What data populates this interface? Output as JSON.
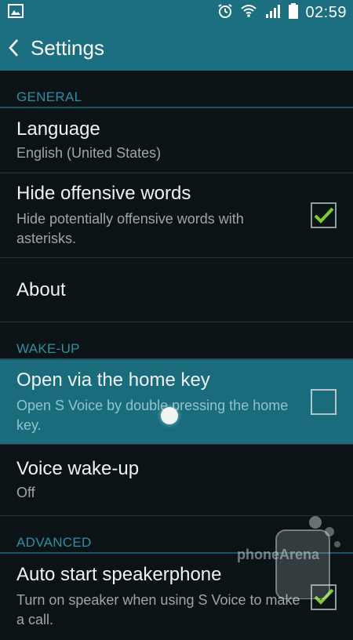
{
  "status_bar": {
    "time": "02:59",
    "icons": [
      "image-icon",
      "alarm-icon",
      "wifi-icon",
      "signal-icon",
      "battery-icon"
    ]
  },
  "action_bar": {
    "title": "Settings",
    "back_icon": "chevron-left-icon"
  },
  "sections": {
    "general": {
      "header": "GENERAL"
    },
    "wakeup": {
      "header": "WAKE-UP"
    },
    "advanced": {
      "header": "ADVANCED"
    }
  },
  "items": {
    "language": {
      "title": "Language",
      "subtitle": "English (United States)"
    },
    "hide_offensive": {
      "title": "Hide offensive words",
      "subtitle": "Hide potentially offensive words with asterisks.",
      "checked": true
    },
    "about": {
      "title": "About"
    },
    "open_home_key": {
      "title": "Open via the home key",
      "subtitle": "Open S Voice by double pressing the home key.",
      "checked": false
    },
    "voice_wakeup": {
      "title": "Voice wake-up",
      "subtitle": "Off"
    },
    "auto_speaker": {
      "title": "Auto start speakerphone",
      "subtitle": "Turn on speaker when using S Voice to make a call.",
      "checked": true
    }
  },
  "watermark": {
    "text": "phoneArena"
  },
  "colors": {
    "accent": "#1b6f80",
    "section_header": "#2f8ea2",
    "check_green": "#7ccf2a",
    "background": "#0b1316"
  }
}
